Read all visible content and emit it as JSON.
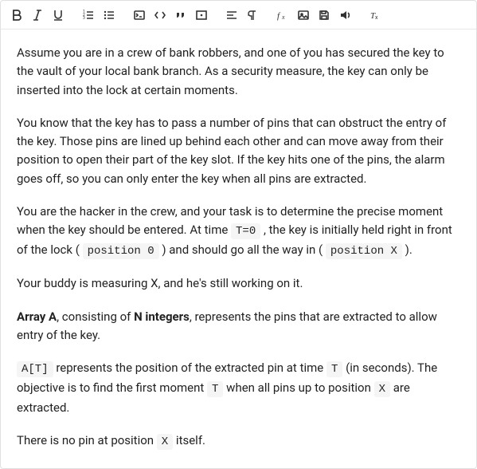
{
  "toolbar": {
    "icons": [
      "bold-icon",
      "italic-icon",
      "underline-icon",
      "ordered-list-icon",
      "unordered-list-icon",
      "terminal-icon",
      "code-icon",
      "quote-icon",
      "math-block-icon",
      "align-icon",
      "paragraph-icon",
      "fx-icon",
      "image-icon",
      "save-icon",
      "audio-icon",
      "clear-format-icon"
    ]
  },
  "content": {
    "p1": "Assume you are in a crew of bank robbers, and one of you has secured the key to the vault of your local bank branch. As a security measure, the key can only be inserted into the lock at certain moments.",
    "p2": "You know that the key has to pass a number of pins that can obstruct the entry of the key. Those pins are lined up behind each other and can move away from their position to open their part of the key slot. If the key hits one of the pins, the alarm goes off, so you can only enter the key when all pins are extracted.",
    "p3a": "You are the hacker in the crew, and your task is to determine the precise moment when the key should be entered. At time ",
    "p3_code1": "T=0",
    "p3b": " , the key is initially held right in front of the lock ( ",
    "p3_code2": "position 0",
    "p3c": " ) and should go all the way in ( ",
    "p3_code3": "position X",
    "p3d": " ).",
    "p4": "Your buddy is measuring X, and he's still working on it.",
    "p5a_bold": "Array A",
    "p5b": ", consisting of ",
    "p5c_bold": "N integers",
    "p5d": ", represents the pins that are extracted to allow entry of the key.",
    "p6_code1": "A[T]",
    "p6a": " represents the position of the extracted pin at time ",
    "p6_code2": "T",
    "p6b": " (in seconds). The objective is to find the first moment ",
    "p6_code3": "T",
    "p6c": " when all pins up to position ",
    "p6_code4": "X",
    "p6d": " are extracted.",
    "p7a": "There is no pin at position ",
    "p7_code1": "X",
    "p7b": " itself."
  }
}
